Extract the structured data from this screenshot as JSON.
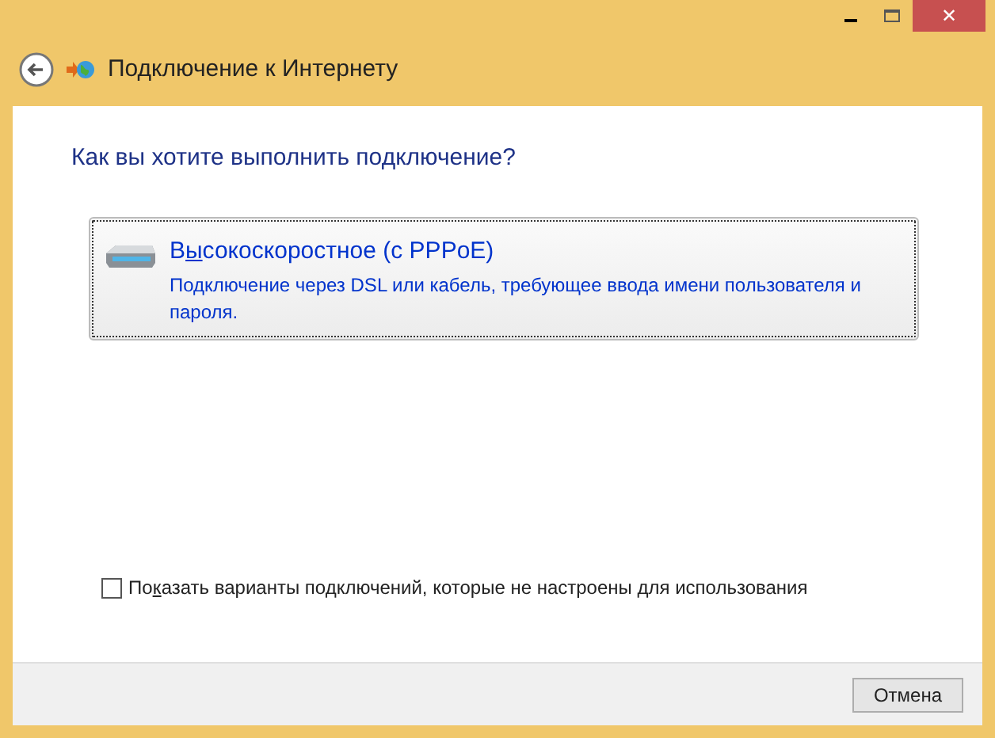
{
  "window": {
    "title": "Подключение к Интернету",
    "close": "✕"
  },
  "heading": "Как вы хотите выполнить подключение?",
  "options": [
    {
      "title_parts": [
        {
          "text": "В",
          "underlined": false
        },
        {
          "text": "ы",
          "underlined": true
        },
        {
          "text": "сокоскоростное (с PPPoE)",
          "underlined": false
        }
      ],
      "description": "Подключение через DSL или кабель, требующее ввода имени пользователя и пароля.",
      "selected": true
    }
  ],
  "show_unconfigured": {
    "label_parts": [
      {
        "text": "По",
        "underlined": false
      },
      {
        "text": "к",
        "underlined": true
      },
      {
        "text": "азать варианты подключений, которые не настроены для использования",
        "underlined": false
      }
    ],
    "checked": false
  },
  "buttons": [
    {
      "label": "Отмена"
    }
  ]
}
